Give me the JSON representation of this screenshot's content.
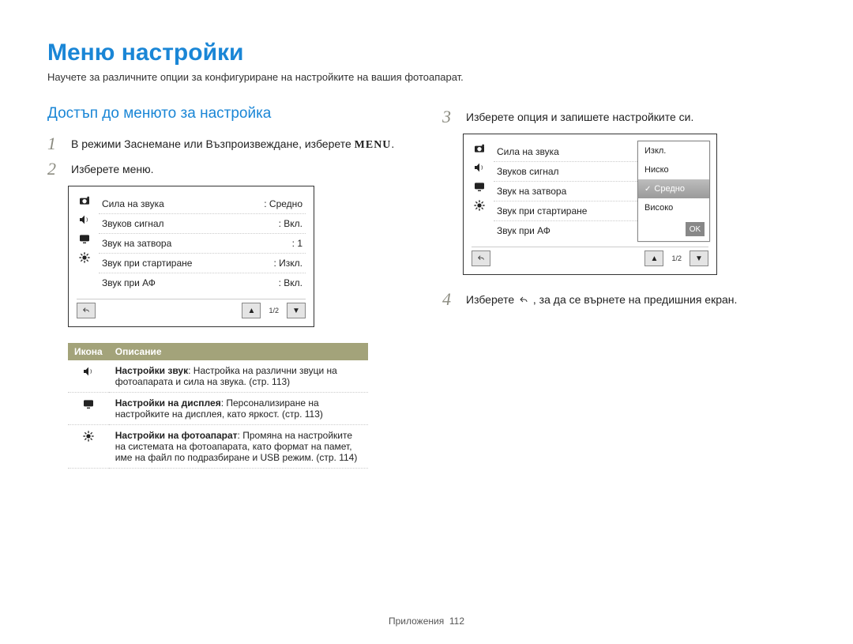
{
  "title": "Меню настройки",
  "intro": "Научете за различните опции за конфигуриране на настройките на вашия фотоапарат.",
  "subtitle": "Достъп до менюто за настройка",
  "steps": {
    "s1": "В режими Заснемане или Възпроизвеждане, изберете ",
    "s1b": "MENU",
    "s1c": ".",
    "s2": "Изберете меню.",
    "s3": "Изберете опция и запишете настройките си.",
    "s4a": "Изберете ",
    "s4b": ", за да се върнете на предишния екран."
  },
  "menu1": {
    "rows": [
      {
        "label": "Сила на звука",
        "val": ": Средно"
      },
      {
        "label": "Звуков сигнал",
        "val": ": Вкл."
      },
      {
        "label": "Звук на затвора",
        "val": ": 1"
      },
      {
        "label": "Звук при стартиране",
        "val": ": Изкл."
      },
      {
        "label": "Звук при АФ",
        "val": ": Вкл."
      }
    ],
    "page": "1/2"
  },
  "menu2": {
    "rows": [
      {
        "label": "Сила на звука"
      },
      {
        "label": "Звуков сигнал"
      },
      {
        "label": "Звук на затвора"
      },
      {
        "label": "Звук при стартиране"
      },
      {
        "label": "Звук при АФ"
      }
    ],
    "options": [
      "Изкл.",
      "Ниско",
      "Средно",
      "Високо"
    ],
    "ok": "OK",
    "page": "1/2"
  },
  "iconTable": {
    "h1": "Икона",
    "h2": "Описание",
    "rows": [
      {
        "title": "Настройки звук",
        "text": ": Настройка на различни звуци на фотоапарата и сила на звука. (стр. 113)"
      },
      {
        "title": "Настройки на дисплея",
        "text": ": Персонализиране на настройките на дисплея, като яркост. (стр. 113)"
      },
      {
        "title": "Настройки на фотоапарат",
        "text": ": Промяна на настройките на системата на фотоапарата, като формат на памет, име на файл по подразбиране и USB режим. (стр. 114)"
      }
    ]
  },
  "footer": {
    "label": "Приложения",
    "page": "112"
  }
}
